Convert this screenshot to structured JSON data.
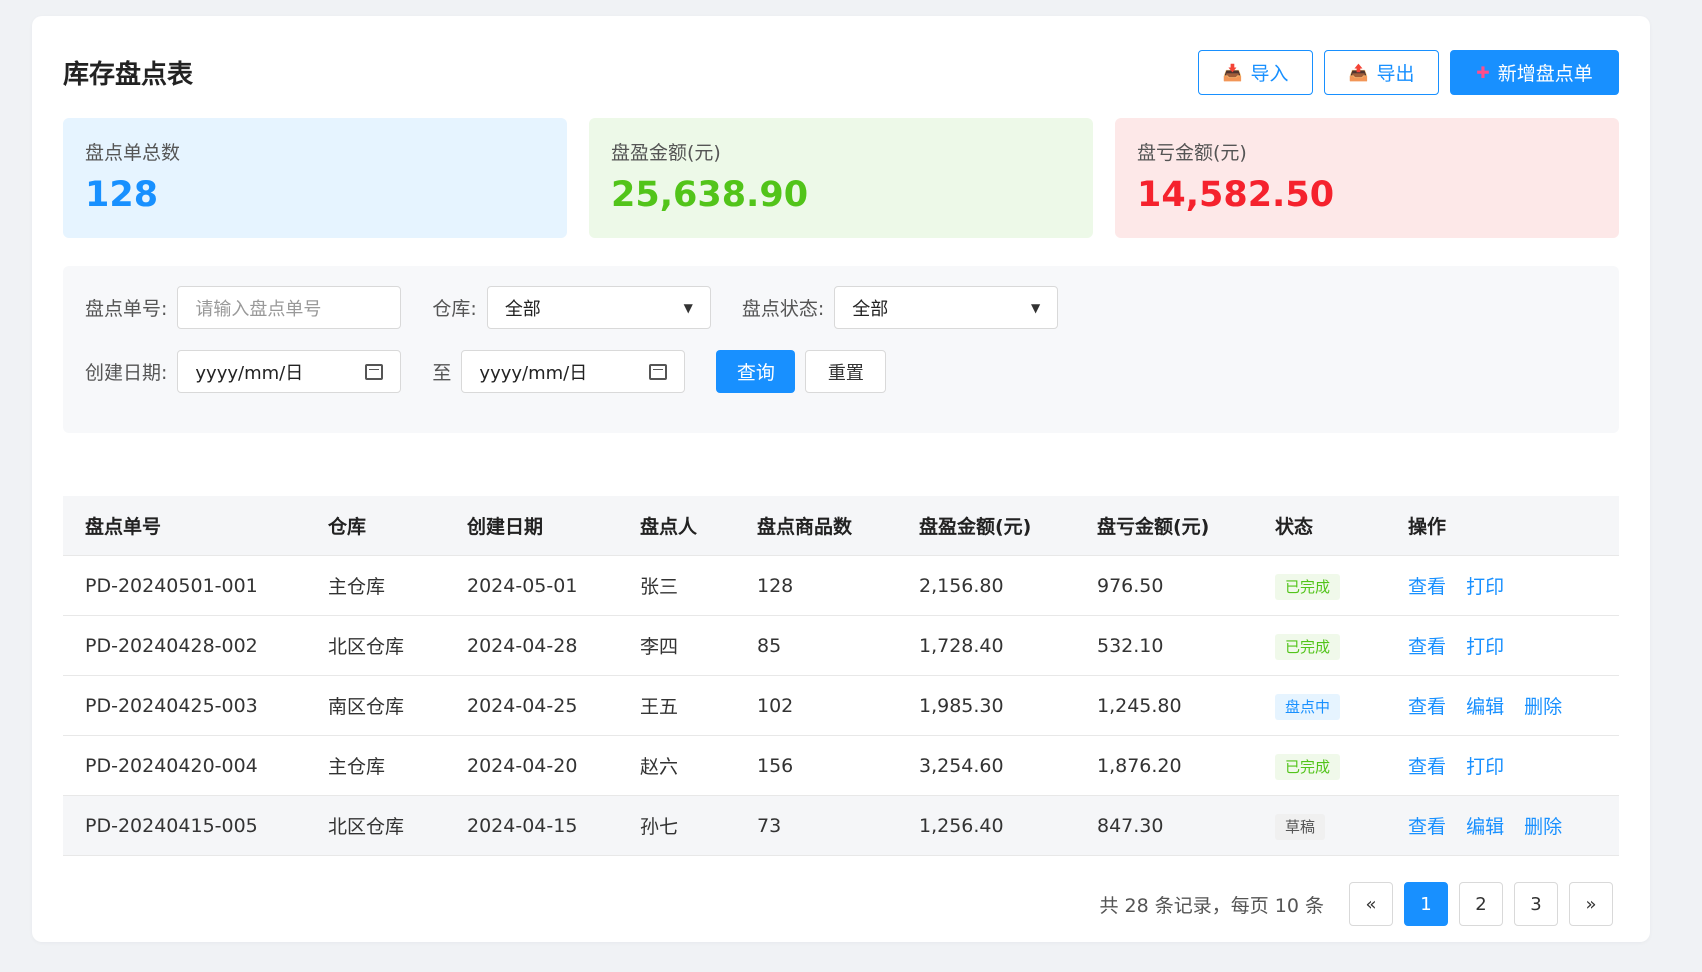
{
  "page": {
    "title": "库存盘点表"
  },
  "actions": {
    "import_label": "导入",
    "export_label": "导出",
    "new_label": "新增盘点单",
    "import_icon": "inbox-icon",
    "export_icon": "outbox-icon",
    "new_icon": "plus-icon"
  },
  "stats": [
    {
      "label": "盘点单总数",
      "value": "128",
      "color": "#1890ff"
    },
    {
      "label": "盘盈金额(元)",
      "value": "25,638.90",
      "color": "#52c41a"
    },
    {
      "label": "盘亏金额(元)",
      "value": "14,582.50",
      "color": "#f5222d"
    }
  ],
  "filters": {
    "order_no_label": "盘点单号:",
    "order_no_placeholder": "请输入盘点单号",
    "warehouse_label": "仓库:",
    "warehouse_value": "全部",
    "status_label": "盘点状态:",
    "status_value": "全部",
    "date_label": "创建日期:",
    "date_from": "yyyy/mm/日",
    "date_sep": "至",
    "date_to": "yyyy/mm/日",
    "query_label": "查询",
    "reset_label": "重置"
  },
  "table": {
    "headers": [
      "盘点单号",
      "仓库",
      "创建日期",
      "盘点人",
      "盘点商品数",
      "盘盈金额(元)",
      "盘亏金额(元)",
      "状态",
      "操作"
    ],
    "rows": [
      {
        "no": "PD-20240501-001",
        "wh": "主仓库",
        "date": "2024-05-01",
        "person": "张三",
        "count": "128",
        "gain": "2,156.80",
        "loss": "976.50",
        "status": "已完成",
        "ops": [
          "查看",
          "打印"
        ]
      },
      {
        "no": "PD-20240428-002",
        "wh": "北区仓库",
        "date": "2024-04-28",
        "person": "李四",
        "count": "85",
        "gain": "1,728.40",
        "loss": "532.10",
        "status": "已完成",
        "ops": [
          "查看",
          "打印"
        ]
      },
      {
        "no": "PD-20240425-003",
        "wh": "南区仓库",
        "date": "2024-04-25",
        "person": "王五",
        "count": "102",
        "gain": "1,985.30",
        "loss": "1,245.80",
        "status": "盘点中",
        "ops": [
          "查看",
          "编辑",
          "删除"
        ]
      },
      {
        "no": "PD-20240420-004",
        "wh": "主仓库",
        "date": "2024-04-20",
        "person": "赵六",
        "count": "156",
        "gain": "3,254.60",
        "loss": "1,876.20",
        "status": "已完成",
        "ops": [
          "查看",
          "打印"
        ]
      },
      {
        "no": "PD-20240415-005",
        "wh": "北区仓库",
        "date": "2024-04-15",
        "person": "孙七",
        "count": "73",
        "gain": "1,256.40",
        "loss": "847.30",
        "status": "草稿",
        "ops": [
          "查看",
          "编辑",
          "删除"
        ]
      }
    ]
  },
  "pagination": {
    "info": "共 28 条记录，每页 10 条",
    "prev": "«",
    "pages": [
      "1",
      "2",
      "3"
    ],
    "current": "1",
    "next": "»"
  }
}
